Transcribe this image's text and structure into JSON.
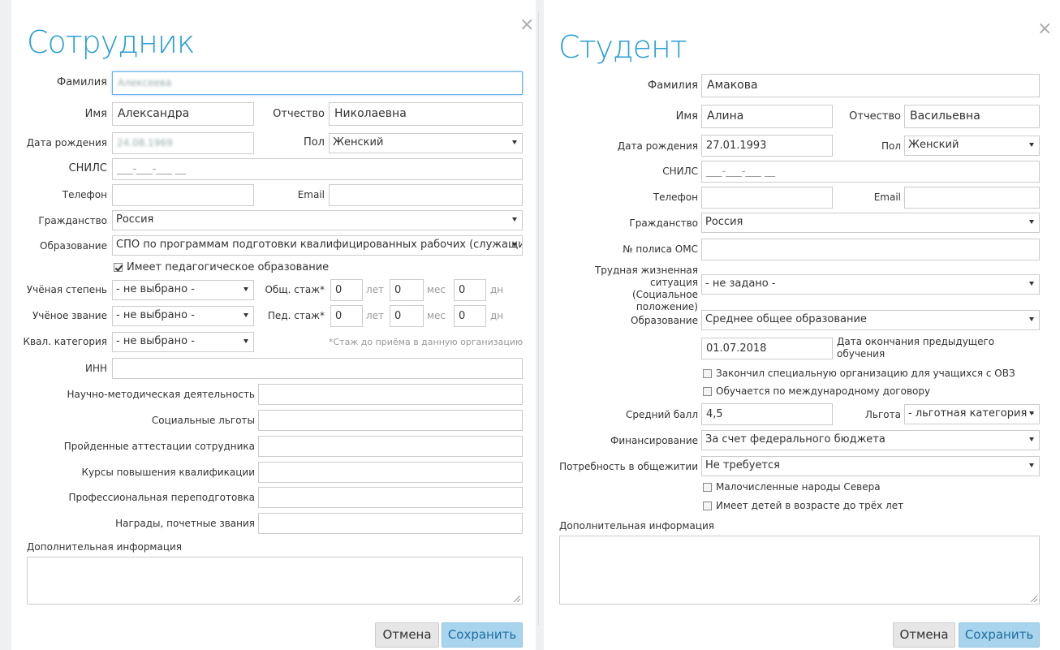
{
  "employee": {
    "title": "Сотрудник",
    "close": "×",
    "labels": {
      "surname": "Фамилия",
      "name": "Имя",
      "patronymic": "Отчество",
      "birth_date": "Дата рождения",
      "gender": "Пол",
      "snils": "СНИЛС",
      "phone": "Телефон",
      "email": "Email",
      "citizenship": "Гражданство",
      "education": "Образование",
      "degree": "Учёная степень",
      "rank": "Учёное звание",
      "qual_category": "Квал. категория",
      "total_exp": "Общ. стаж*",
      "ped_exp": "Пед. стаж*",
      "inn": "ИНН",
      "research": "Научно-методическая деятельность",
      "social_benefits": "Социальные льготы",
      "attestations": "Пройденные аттестации сотрудника",
      "courses": "Курсы повышения квалификации",
      "retraining": "Профессиональная переподготовка",
      "awards": "Награды, почетные звания",
      "additional": "Дополнительная информация"
    },
    "values": {
      "surname": "Алексеева",
      "name": "Александра",
      "patronymic": "Николаевна",
      "birth_date": "24.08.1969",
      "gender": "Женский",
      "snils_placeholder": "___-___-___ __",
      "citizenship": "Россия",
      "education": "СПО по программам подготовки квалифицированных рабочих (служащих)",
      "degree": "- не выбрано -",
      "rank": "- не выбрано -",
      "qual_category": "- не выбрано -",
      "total_years": "0",
      "total_months": "0",
      "total_days": "0",
      "ped_years": "0",
      "ped_months": "0",
      "ped_days": "0"
    },
    "units": {
      "years": "лет",
      "months": "мес",
      "days": "дн"
    },
    "ped_education_checkbox": "Имеет педагогическое образование",
    "exp_note": "*Стаж до приёма в данную организацию",
    "buttons": {
      "cancel": "Отмена",
      "save": "Сохранить"
    }
  },
  "student": {
    "title": "Студент",
    "close": "×",
    "labels": {
      "surname": "Фамилия",
      "name": "Имя",
      "patronymic": "Отчество",
      "birth_date": "Дата рождения",
      "gender": "Пол",
      "snils": "СНИЛС",
      "phone": "Телефон",
      "email": "Email",
      "citizenship": "Гражданство",
      "oms": "№ полиса ОМС",
      "hard_situation": "Трудная жизненная ситуация (Социальное положение)",
      "education": "Образование",
      "prev_end": "Дата окончания предыдущего обучения",
      "avg_score": "Средний балл",
      "benefit": "Льгота",
      "financing": "Финансирование",
      "dormitory": "Потребность в общежитии",
      "additional": "Дополнительная информация"
    },
    "values": {
      "surname": "Амакова",
      "name": "Алина",
      "patronymic": "Васильевна",
      "birth_date": "27.01.1993",
      "gender": "Женский",
      "snils_placeholder": "___-___-___ __",
      "citizenship": "Россия",
      "hard_situation": "- не задано -",
      "education": "Среднее общее образование",
      "prev_end": "01.07.2018",
      "avg_score": "4,5",
      "benefit": "- льготная категория -",
      "financing": "За счет федерального бюджета",
      "dormitory": "Не требуется"
    },
    "checkboxes": {
      "ovz": "Закончил специальную организацию для учащихся с ОВЗ",
      "intl": "Обучается по международному договору",
      "north": "Малочисленные народы Севера",
      "children": "Имеет детей в возрасте до трёх лет"
    },
    "buttons": {
      "cancel": "Отмена",
      "save": "Сохранить"
    }
  }
}
